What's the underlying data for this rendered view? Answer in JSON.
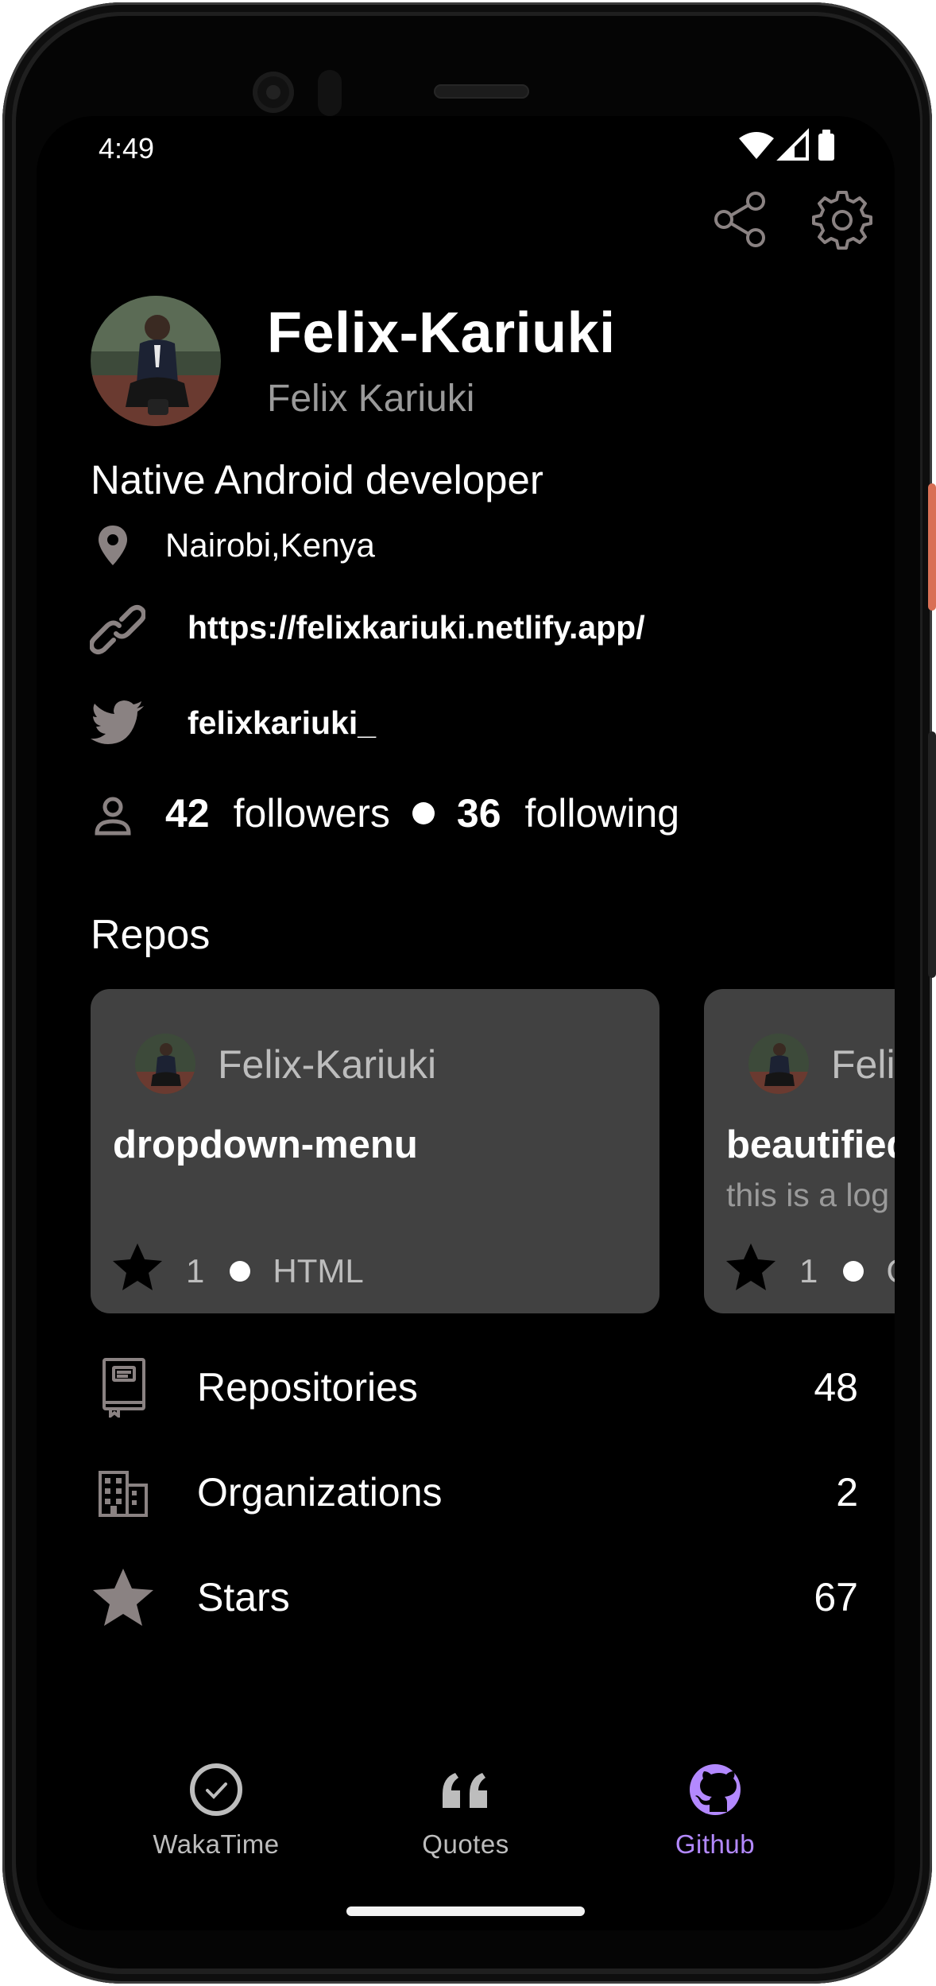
{
  "status_bar": {
    "time": "4:49"
  },
  "profile": {
    "username": "Felix-Kariuki",
    "full_name": "Felix Kariuki",
    "bio": "Native Android developer",
    "location": "Nairobi,Kenya",
    "website": "https://felixkariuki.netlify.app/",
    "twitter": "felixkariuki_",
    "followers_count": "42",
    "followers_label": "followers",
    "following_count": "36",
    "following_label": "following"
  },
  "repos": {
    "title": "Repos",
    "cards": [
      {
        "owner": "Felix-Kariuki",
        "name": "dropdown-menu",
        "description": "",
        "stars": "1",
        "language": "HTML"
      },
      {
        "owner": "Felix-Kariuki",
        "name": "beautified",
        "description": "this is a log",
        "stars": "1",
        "language": "C"
      }
    ]
  },
  "menu": [
    {
      "label": "Repositories",
      "count": "48",
      "icon": "book-icon"
    },
    {
      "label": "Organizations",
      "count": "2",
      "icon": "building-icon"
    },
    {
      "label": "Stars",
      "count": "67",
      "icon": "star-icon"
    }
  ],
  "bottom_nav": [
    {
      "label": "WakaTime",
      "icon": "clock-icon",
      "active": false
    },
    {
      "label": "Quotes",
      "icon": "quote-icon",
      "active": false
    },
    {
      "label": "Github",
      "icon": "github-icon",
      "active": true
    }
  ],
  "colors": {
    "background": "#000000",
    "card": "#414141",
    "accent": "#b389ff",
    "muted": "#9a9a9a",
    "icon": "#8a8282"
  }
}
